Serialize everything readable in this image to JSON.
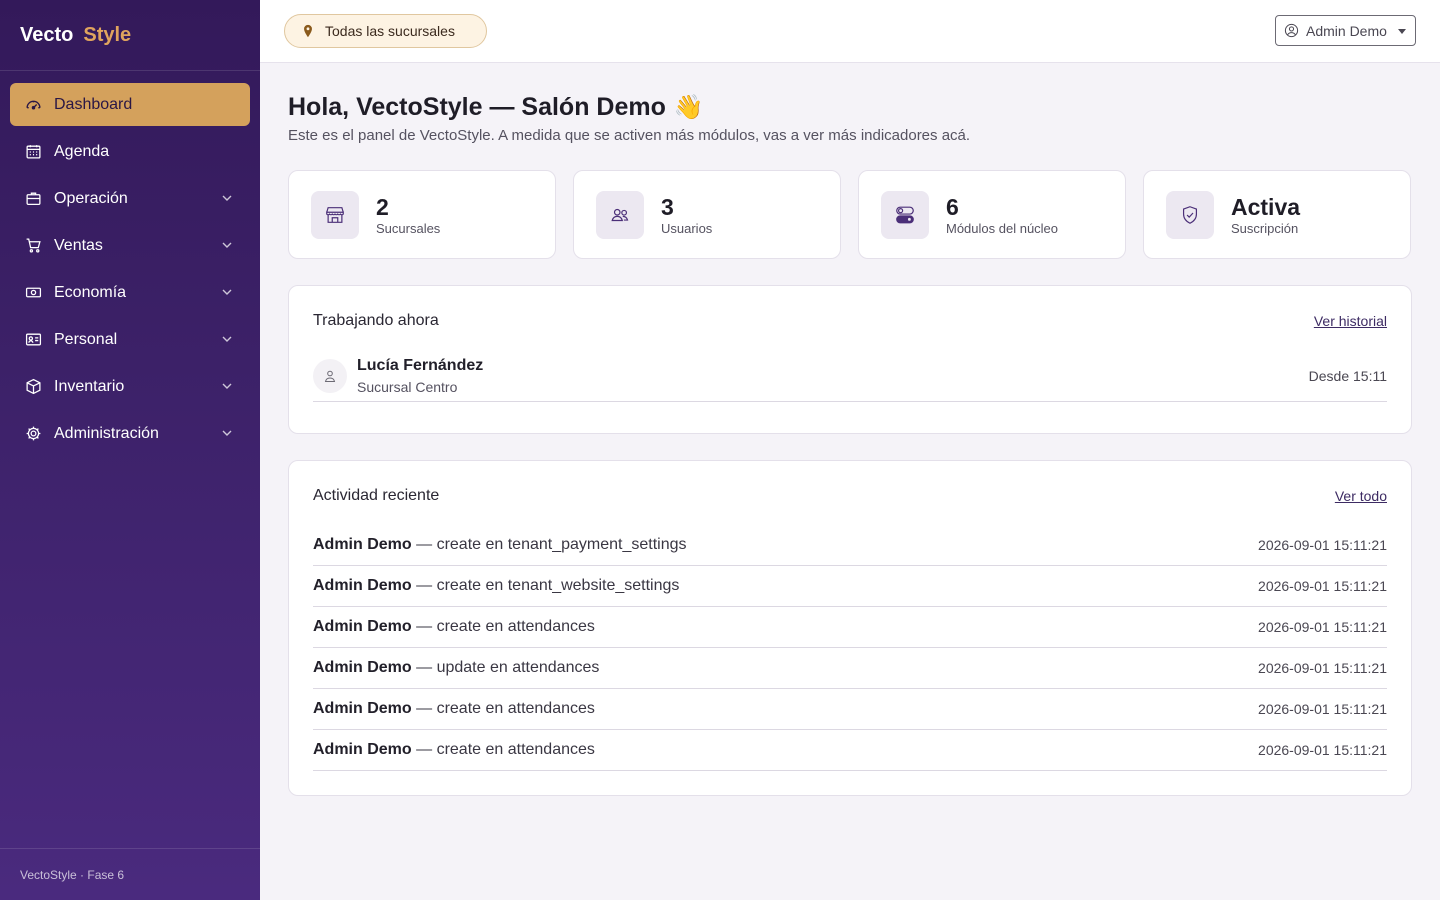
{
  "brand": {
    "part1": "Vecto",
    "part2": "Style"
  },
  "sidebar": {
    "items": [
      {
        "label": "Dashboard",
        "icon": "speedometer-icon",
        "active": true
      },
      {
        "label": "Agenda",
        "icon": "calendar-icon"
      },
      {
        "label": "Operación",
        "icon": "briefcase-icon"
      },
      {
        "label": "Ventas",
        "icon": "cart-icon"
      },
      {
        "label": "Economía",
        "icon": "cash-icon"
      },
      {
        "label": "Personal",
        "icon": "id-card-icon"
      },
      {
        "label": "Inventario",
        "icon": "box-icon"
      },
      {
        "label": "Administración",
        "icon": "gear-icon"
      }
    ],
    "footer": "VectoStyle · Fase 6"
  },
  "topbar": {
    "branch": "Todas las sucursales",
    "user": "Admin Demo"
  },
  "main": {
    "greeting": "Hola, VectoStyle — Salón Demo",
    "greeting_emoji": "👋",
    "subtitle": "Este es el panel de VectoStyle. A medida que se activen más módulos, vas a ver más indicadores acá.",
    "stats": [
      {
        "value": "2",
        "label": "Sucursales",
        "icon": "shop-icon"
      },
      {
        "value": "3",
        "label": "Usuarios",
        "icon": "users-icon"
      },
      {
        "value": "6",
        "label": "Módulos del núcleo",
        "icon": "toggles-icon"
      },
      {
        "value": "Activa",
        "label": "Suscripción",
        "icon": "shield-check-icon"
      }
    ],
    "working": {
      "title": "Trabajando ahora",
      "link": "Ver historial",
      "people": [
        {
          "name": "Lucía Fernández",
          "branch": "Sucursal Centro",
          "since": "Desde 15:11"
        }
      ]
    },
    "activity": {
      "title": "Actividad reciente",
      "link": "Ver todo",
      "items": [
        {
          "who": "Admin Demo",
          "what": " — create en tenant_payment_settings",
          "when": "2026-09-01 15:11:21"
        },
        {
          "who": "Admin Demo",
          "what": " — create en tenant_website_settings",
          "when": "2026-09-01 15:11:21"
        },
        {
          "who": "Admin Demo",
          "what": " — create en attendances",
          "when": "2026-09-01 15:11:21"
        },
        {
          "who": "Admin Demo",
          "what": " — update en attendances",
          "when": "2026-09-01 15:11:21"
        },
        {
          "who": "Admin Demo",
          "what": " — create en attendances",
          "when": "2026-09-01 15:11:21"
        },
        {
          "who": "Admin Demo",
          "what": " — create en attendances",
          "when": "2026-09-01 15:11:21"
        }
      ]
    }
  },
  "colors": {
    "sidebar_top": "#33195a",
    "sidebar_bottom": "#4a2a7e",
    "accent": "#d4a15c",
    "brand_accent": "#e0a45e"
  }
}
